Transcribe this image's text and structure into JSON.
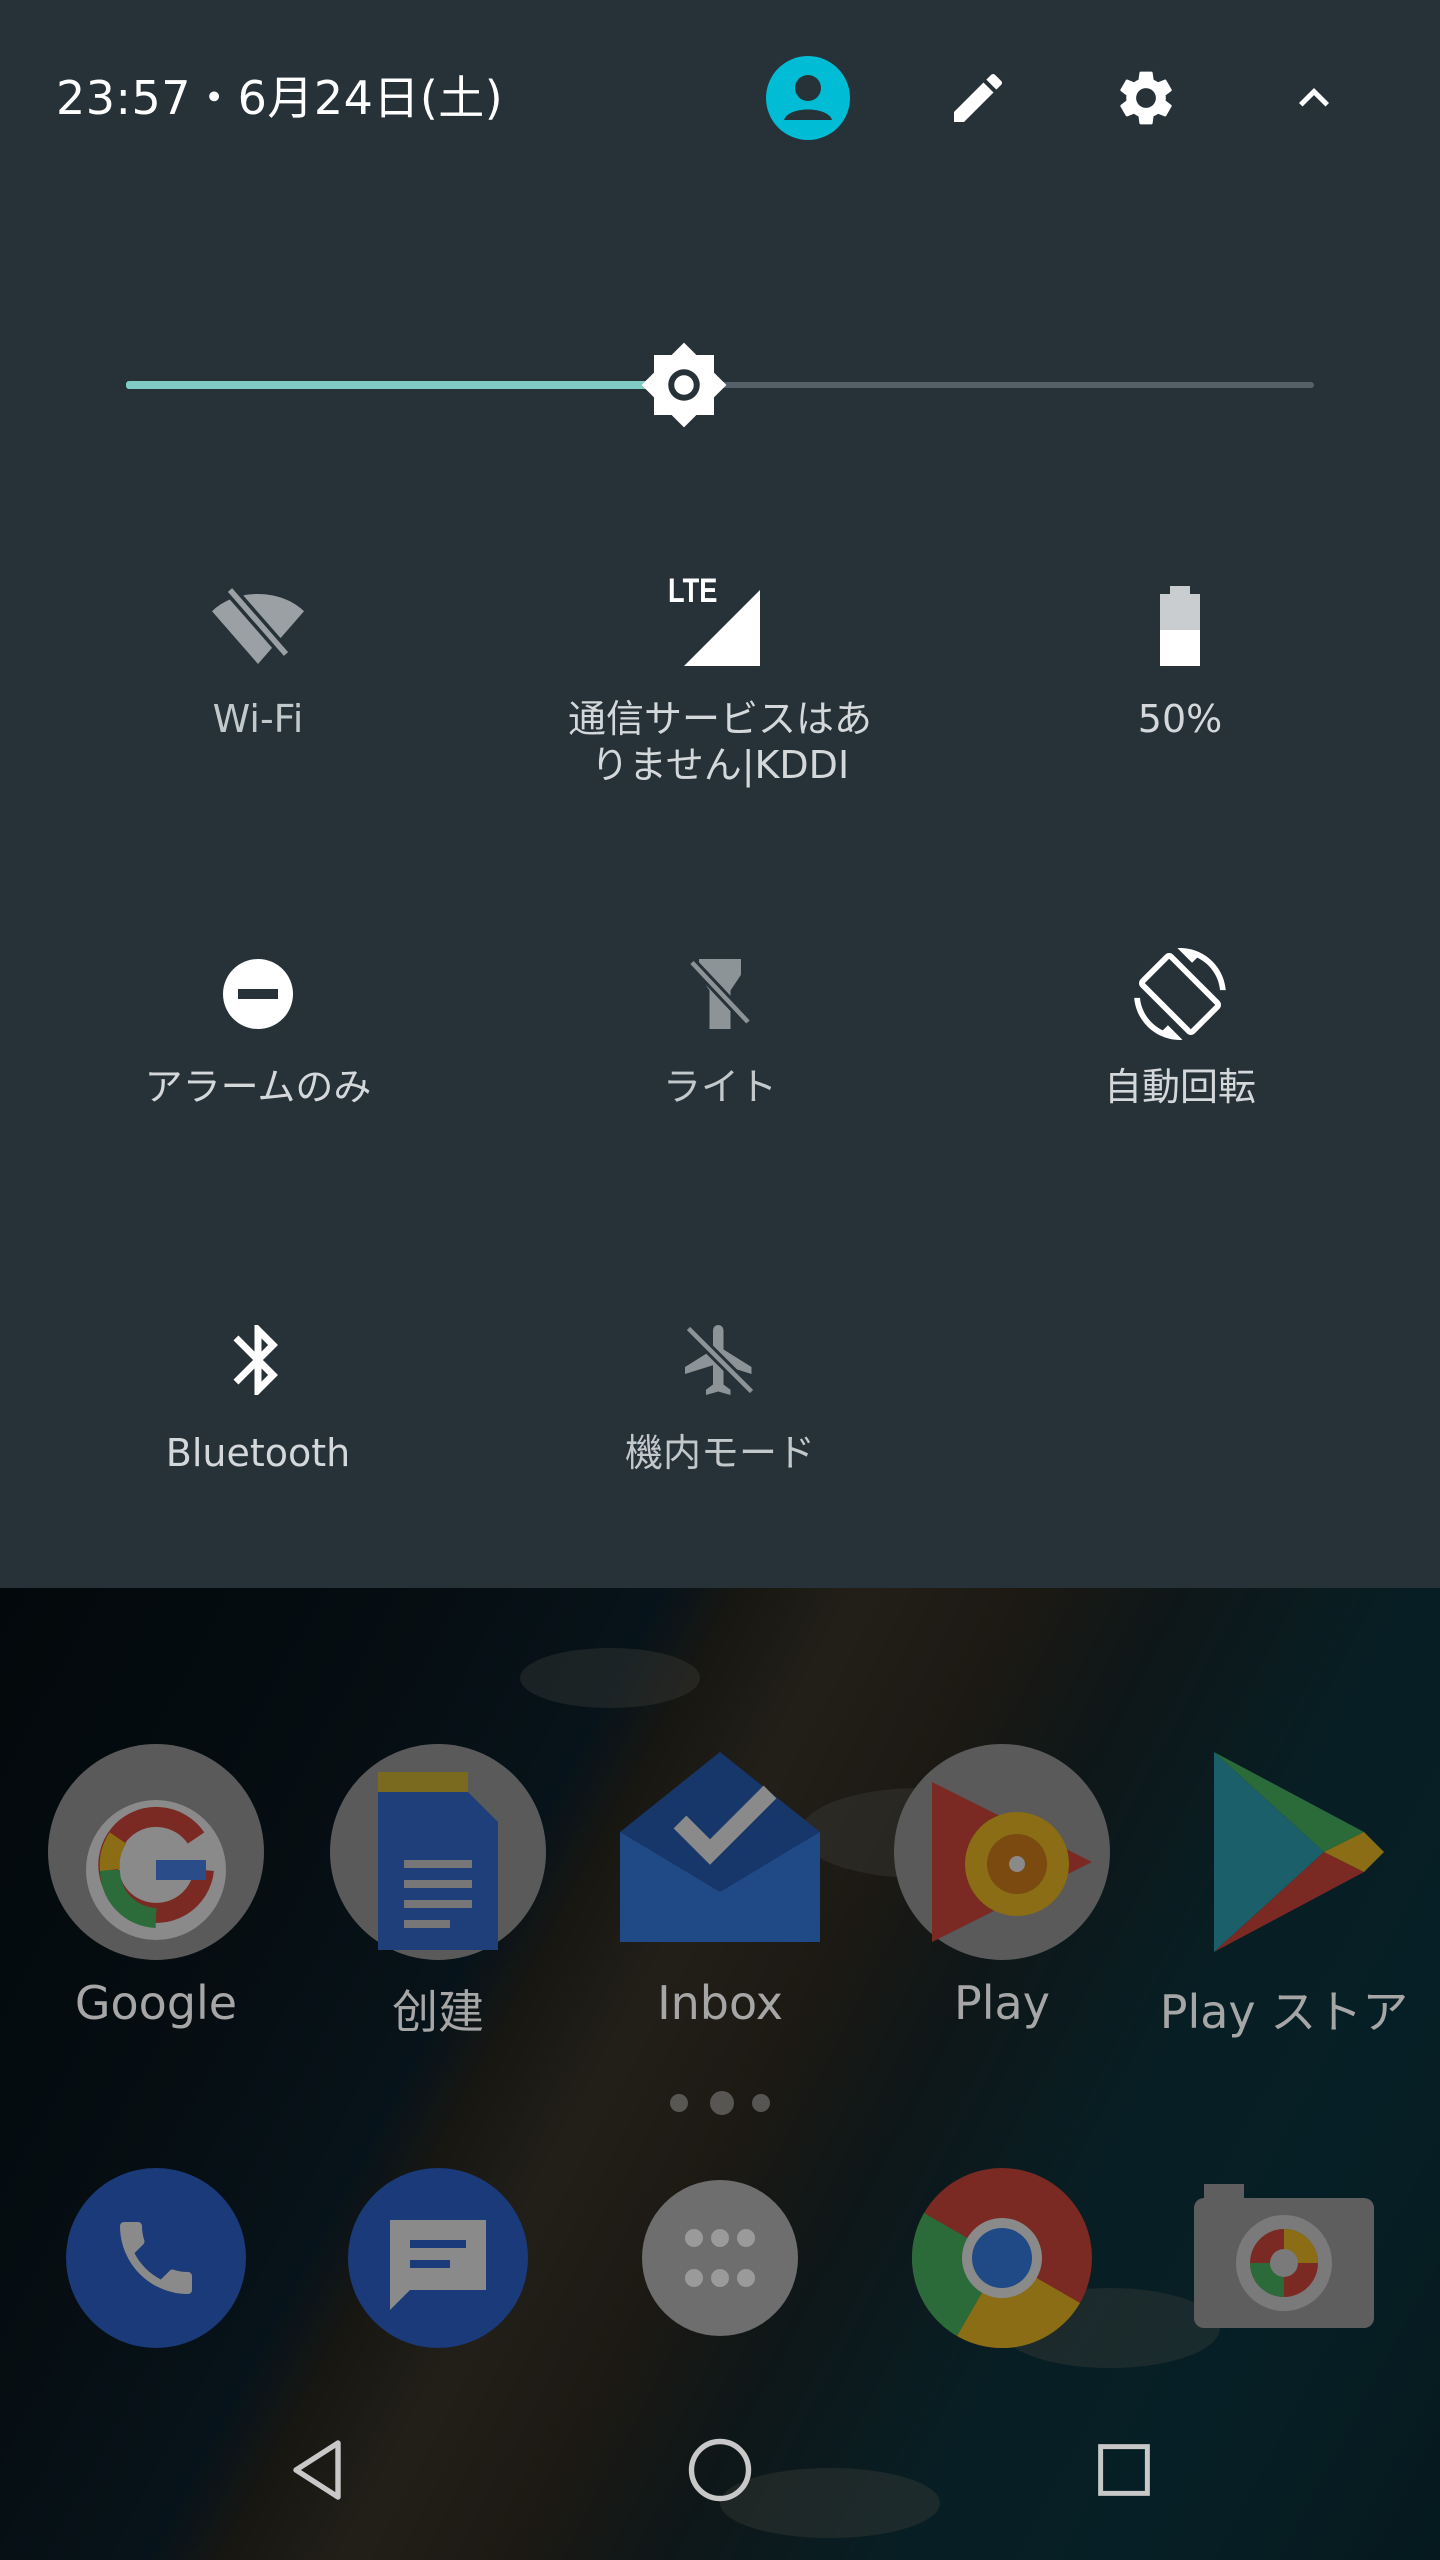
{
  "status": {
    "datetime": "23:57・6月24日(土)"
  },
  "header_buttons": [
    {
      "icon": "account-icon",
      "color": "#00bcd4"
    },
    {
      "icon": "edit-icon"
    },
    {
      "icon": "settings-icon"
    },
    {
      "icon": "collapse-icon"
    }
  ],
  "brightness": {
    "level": 0.47,
    "active_color": "#80cbc4",
    "track_color": "#566069"
  },
  "tiles": [
    {
      "label": "Wi-Fi",
      "icon": "wifi-off-icon",
      "state": "off"
    },
    {
      "label": "通信サービスはあ",
      "label2": "りません|KDDI",
      "icon": "lte-signal-icon",
      "badge": "LTE",
      "state": "on"
    },
    {
      "label": "50%",
      "icon": "battery-icon",
      "level": 0.5,
      "state": "on"
    },
    {
      "label": "アラームのみ",
      "icon": "do-not-disturb-icon",
      "state": "on"
    },
    {
      "label": "ライト",
      "icon": "flashlight-off-icon",
      "state": "off"
    },
    {
      "label": "自動回転",
      "icon": "auto-rotate-icon",
      "state": "on"
    },
    {
      "label": "Bluetooth",
      "icon": "bluetooth-icon",
      "state": "on"
    },
    {
      "label": "機内モード",
      "icon": "airplane-mode-icon",
      "state": "off"
    }
  ],
  "home": {
    "apps": [
      {
        "label": "Google",
        "icon": "google-folder-icon"
      },
      {
        "label": "创建",
        "icon": "docs-folder-icon"
      },
      {
        "label": "Inbox",
        "icon": "inbox-icon"
      },
      {
        "label": "Play",
        "icon": "play-music-folder-icon"
      },
      {
        "label": "Play ストア",
        "icon": "play-store-icon"
      }
    ],
    "dock": [
      {
        "icon": "phone-icon"
      },
      {
        "icon": "messages-icon"
      },
      {
        "icon": "app-drawer-icon"
      },
      {
        "icon": "chrome-icon"
      },
      {
        "icon": "camera-icon"
      }
    ],
    "page_dots": 3
  },
  "navbar": [
    {
      "icon": "back-icon"
    },
    {
      "icon": "home-icon"
    },
    {
      "icon": "recents-icon"
    }
  ]
}
